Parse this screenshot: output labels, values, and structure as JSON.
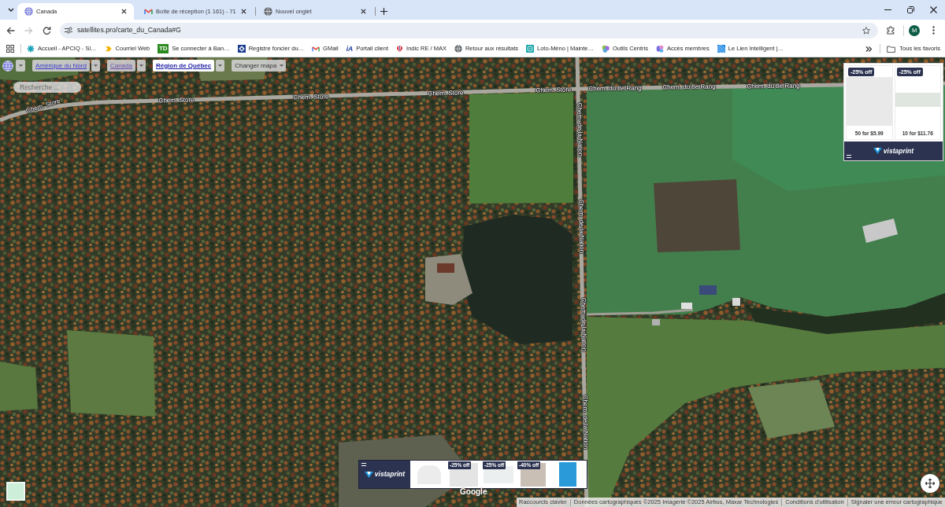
{
  "browser": {
    "tabs": [
      {
        "title": "Canada",
        "selected": true
      },
      {
        "title": "Boîte de réception (1 161) - 71",
        "selected": false
      },
      {
        "title": "Nouvel onglet",
        "selected": false
      }
    ],
    "forward_button": {
      "disabled": true
    },
    "address": {
      "url": "satellites.pro/carte_du_Canada#G"
    },
    "profile": {
      "initial": "M"
    },
    "bookmarks": [
      {
        "label": "Accueil - APCIQ - Si…"
      },
      {
        "label": "Courriel Web"
      },
      {
        "label": "Se connecter à Ban…",
        "icon_text": "TD"
      },
      {
        "label": "Registre foncier du…"
      },
      {
        "label": "GMail"
      },
      {
        "label": "Portail client",
        "icon_text": "iA"
      },
      {
        "label": "Indic RE / MAX"
      },
      {
        "label": "Retour aux résultats"
      },
      {
        "label": "Loto-Méno | Mainte…"
      },
      {
        "label": "Outils Centris"
      },
      {
        "label": "Accès membres"
      },
      {
        "label": "Le Lien Intelligent |…"
      }
    ],
    "all_bookmarks": {
      "label": "Tous les favoris"
    }
  },
  "map": {
    "region_nav": [
      {
        "label": "Amérique du Nord",
        "selected": false,
        "visited": false
      },
      {
        "label": "Canada",
        "selected": false,
        "visited": true
      },
      {
        "label": "Région de Québec",
        "selected": true,
        "visited": false
      }
    ],
    "map_type_menu": {
      "label": "Changer mapa"
    },
    "search": {
      "placeholder": "Recherche ..."
    },
    "road_labels": [
      "Chem. Store",
      "Chem. Store",
      "Chem. Store",
      "Chem. Store",
      "Chem. Store",
      "Chem. du 8e Rang",
      "Chem. du 8e Rang",
      "Chem. du 8e Rang",
      "Chem. de la Nation",
      "Chem. de la Nation",
      "Chem. de la Nation",
      "Chem. de la Nation"
    ],
    "ad_top": {
      "offers": [
        {
          "badge": "-25% off",
          "price": "50 for $5.99"
        },
        {
          "badge": "-25% off",
          "price": "10 for $11.76"
        }
      ],
      "logo": "vistaprint"
    },
    "ad_bottom": {
      "logo": "vistaprint",
      "products": [
        {
          "kind": "plain"
        },
        {
          "kind": "offer",
          "badge": "-25% off"
        },
        {
          "kind": "offer",
          "badge": "-25% off"
        },
        {
          "kind": "offer",
          "badge": "-40% off"
        },
        {
          "kind": "plain"
        }
      ]
    },
    "provider_logo": "Google",
    "attribution": [
      "Raccourcis clavier",
      "Données cartographiques ©2025 Imagerie ©2025 Airbus, Maxar Technologies",
      "Conditions d'utilisation",
      "Signaler une erreur cartographique"
    ]
  }
}
